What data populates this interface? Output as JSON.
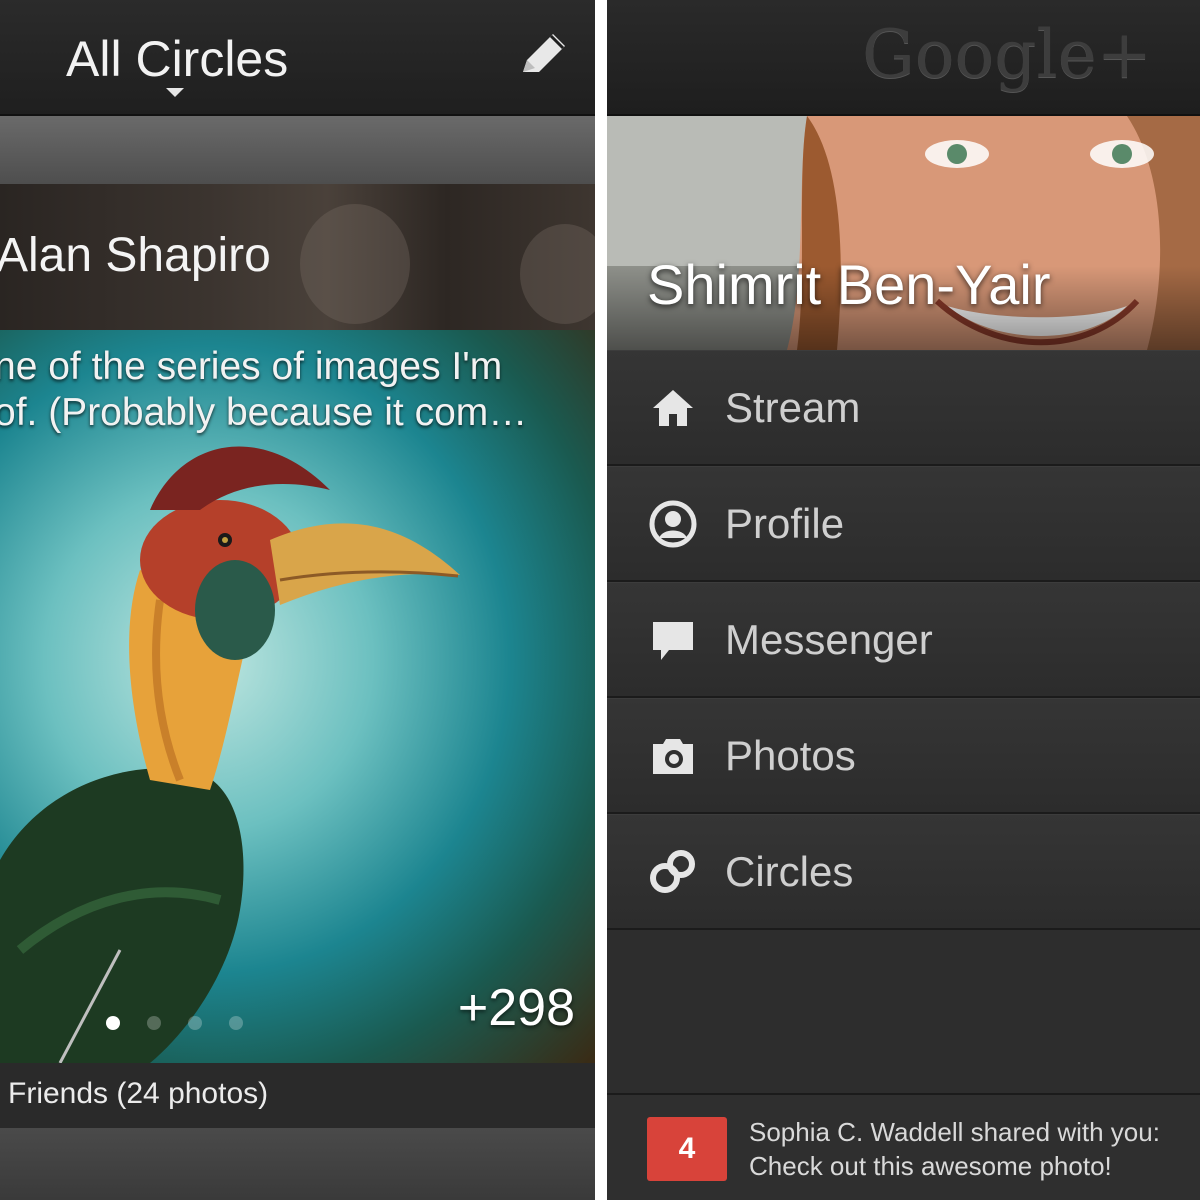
{
  "left_panel": {
    "header": {
      "title": "All Circles"
    },
    "post": {
      "author": "Alan Shapiro",
      "text_line1": "ne of the series of images I'm",
      "text_line2": "of. (Probably because it com…",
      "photo_count": "+298",
      "pager": {
        "total": 4,
        "active": 1
      },
      "album_label": "Friends (24 photos)"
    }
  },
  "right_panel": {
    "logo": "Google+",
    "profile": {
      "name": "Shimrit Ben-Yair"
    },
    "menu": [
      {
        "label": "Stream",
        "icon": "home-icon"
      },
      {
        "label": "Profile",
        "icon": "profile-icon"
      },
      {
        "label": "Messenger",
        "icon": "speech-bubble-icon"
      },
      {
        "label": "Photos",
        "icon": "camera-icon"
      },
      {
        "label": "Circles",
        "icon": "circles-icon"
      }
    ],
    "notification": {
      "count": "4",
      "line1": "Sophia C. Waddell shared with you:",
      "line2": "Check out this awesome photo!"
    }
  },
  "colors": {
    "notification_badge": "#d8433a",
    "menu_text": "#cfcfcf",
    "header_bg": "#1f1f1f"
  }
}
